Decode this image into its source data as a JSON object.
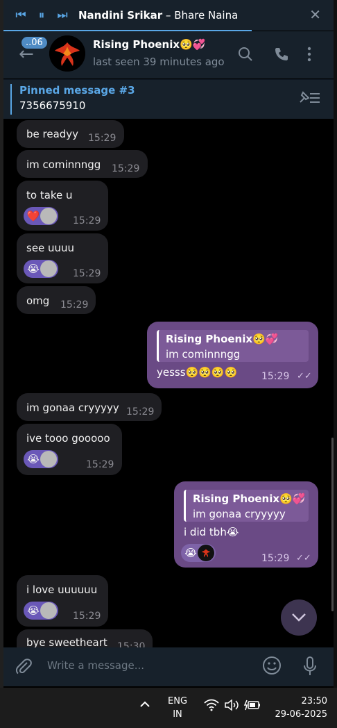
{
  "titlebar": {
    "song_artist": "Nandini Srikar",
    "separator": "–",
    "song_title": "Bhare Naina",
    "prev_icon": "skip-back-icon",
    "pause_icon": "pause-icon",
    "next_icon": "skip-forward-icon",
    "close_glyph": "✕"
  },
  "header": {
    "unread_badge": "..06",
    "chat_name": "Rising Phoenix🥺💞",
    "status": "last seen 39 minutes ago"
  },
  "pinned": {
    "title": "Pinned message #3",
    "text": "7356675910"
  },
  "messages": [
    {
      "text": "be readyy",
      "time": "15:29"
    },
    {
      "text": "im cominnngg",
      "time": "15:29"
    },
    {
      "text": "to take u",
      "time": "15:29",
      "reaction": "❤️"
    },
    {
      "text": "see uuuu",
      "time": "15:29",
      "reaction": "😭"
    },
    {
      "text": "omg",
      "time": "15:29"
    },
    {
      "reply_name": "Rising Phoenix🥺💞",
      "reply_text": "im cominnngg",
      "text": "yesss🥺🥺🥺🥺",
      "time": "15:29"
    },
    {
      "text": "im gonaa cryyyyy",
      "time": "15:29"
    },
    {
      "text": "ive tooo gooooo",
      "time": "15:29",
      "reaction": "😭"
    },
    {
      "reply_name": "Rising Phoenix🥺💞",
      "reply_text": "im gonaa cryyyyy",
      "text": "i did tbh😭",
      "time": "15:29",
      "reaction": "😭"
    },
    {
      "text": "i love uuuuuu",
      "time": "15:29",
      "reaction": "😭"
    },
    {
      "text": "bye sweetheart",
      "time": "15:30"
    }
  ],
  "composer": {
    "placeholder": "Write a message..."
  },
  "taskbar": {
    "lang_1": "ENG",
    "lang_2": "IN",
    "time": "23:50",
    "date": "29-06-2025"
  },
  "colors": {
    "accent": "#5aa7e6",
    "outgoing_bubble": "#6a4a85",
    "incoming_bubble": "#1f1f23",
    "header_bg": "#17212b"
  }
}
